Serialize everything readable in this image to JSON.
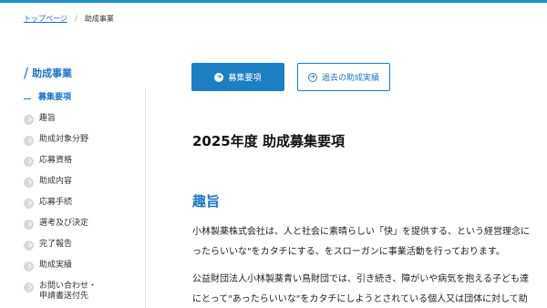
{
  "breadcrumb": {
    "home": "トップページ",
    "separator": "/",
    "current": "助成事業"
  },
  "sidebar": {
    "title": "助成事業",
    "items": [
      {
        "label": "募集要項",
        "current": true
      },
      {
        "label": "趣旨"
      },
      {
        "label": "助成対象分野"
      },
      {
        "label": "応募資格"
      },
      {
        "label": "助成内容"
      },
      {
        "label": "応募手続"
      },
      {
        "label": "選考及び決定"
      },
      {
        "label": "完了報告"
      },
      {
        "label": "助成実績"
      },
      {
        "label_line1": "お問い合わせ・",
        "label_line2": "申請書送付先"
      }
    ]
  },
  "buttons": {
    "primary": "募集要項",
    "secondary": "過去の助成実績"
  },
  "main": {
    "title": "2025年度 助成募集要項",
    "section_title": "趣旨",
    "para1_line1": "小林製薬株式会社は、人と社会に素晴らしい「快」を提供する、という経営理念に",
    "para1_line2": "ったらいいな\"をカタチにする、をスローガンに事業活動を行っております。",
    "para2_line1": "公益財団法人小林製薬青い鳥財団では、引き続き、障がいや病気を抱える子ども達",
    "para2_line2": "にとって\"あったらいいな\"をカタチにしようとされている個人又は団体に対して助"
  },
  "colors": {
    "accent": "#1b7fc4",
    "top_bar": "#1b8fd0"
  }
}
